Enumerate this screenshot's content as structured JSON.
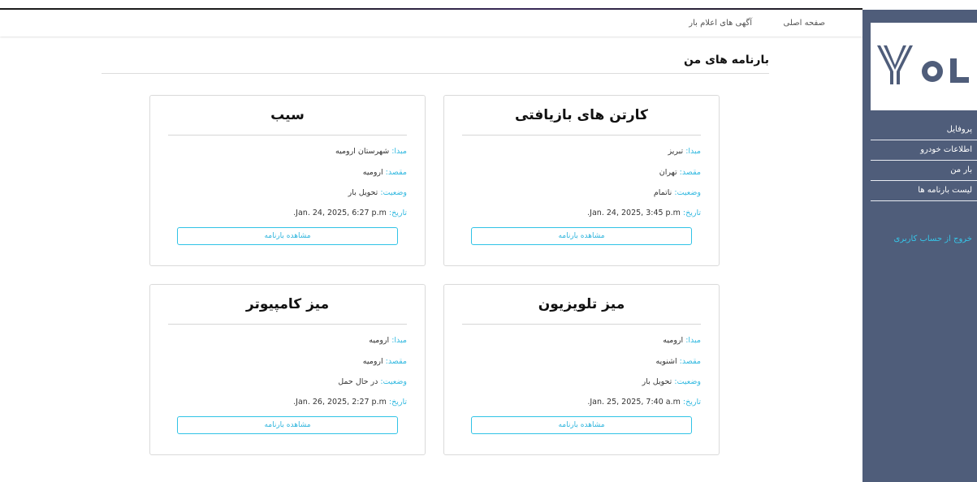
{
  "topnav": {
    "home": "صفحه اصلی",
    "ads": "آگهی های اعلام بار"
  },
  "sidebar": {
    "logo_text": "YOL",
    "items": [
      {
        "label": "پروفایل"
      },
      {
        "label": "اطلاعات خودرو"
      },
      {
        "label": "بار من"
      },
      {
        "label": "لیست بارنامه ها"
      }
    ],
    "logout": "خروج از حساب کاربری"
  },
  "page": {
    "title": "بارنامه های من"
  },
  "labels": {
    "origin": "مبدا:",
    "destination": "مقصد:",
    "status": "وضعیت:",
    "date": "تاریخ:"
  },
  "cards": [
    {
      "title": "کارتن های بازیافتی",
      "origin": "تبریز",
      "destination": "تهران",
      "status": "ناتمام",
      "date": "Jan. 24, 2025, 3:45 p.m.",
      "button": "مشاهده بارنامه"
    },
    {
      "title": "سیب",
      "origin": "شهرستان ارومیه",
      "destination": "ارومیه",
      "status": "تحویل بار",
      "date": "Jan. 24, 2025, 6:27 p.m.",
      "button": "مشاهده بارنامه"
    },
    {
      "title": "میز تلویزیون",
      "origin": "ارومیه",
      "destination": "اشنویه",
      "status": "تحویل بار",
      "date": "Jan. 25, 2025, 7:40 a.m.",
      "button": "مشاهده بارنامه"
    },
    {
      "title": "میز کامپیوتر",
      "origin": "ارومیه",
      "destination": "ارومیه",
      "status": "در حال حمل",
      "date": "Jan. 26, 2025, 2:27 p.m.",
      "button": "مشاهده بارنامه"
    }
  ],
  "colors": {
    "sidebar": "#4f5d7a",
    "accent": "#33b9e0",
    "logo": "#4f5d7a"
  }
}
